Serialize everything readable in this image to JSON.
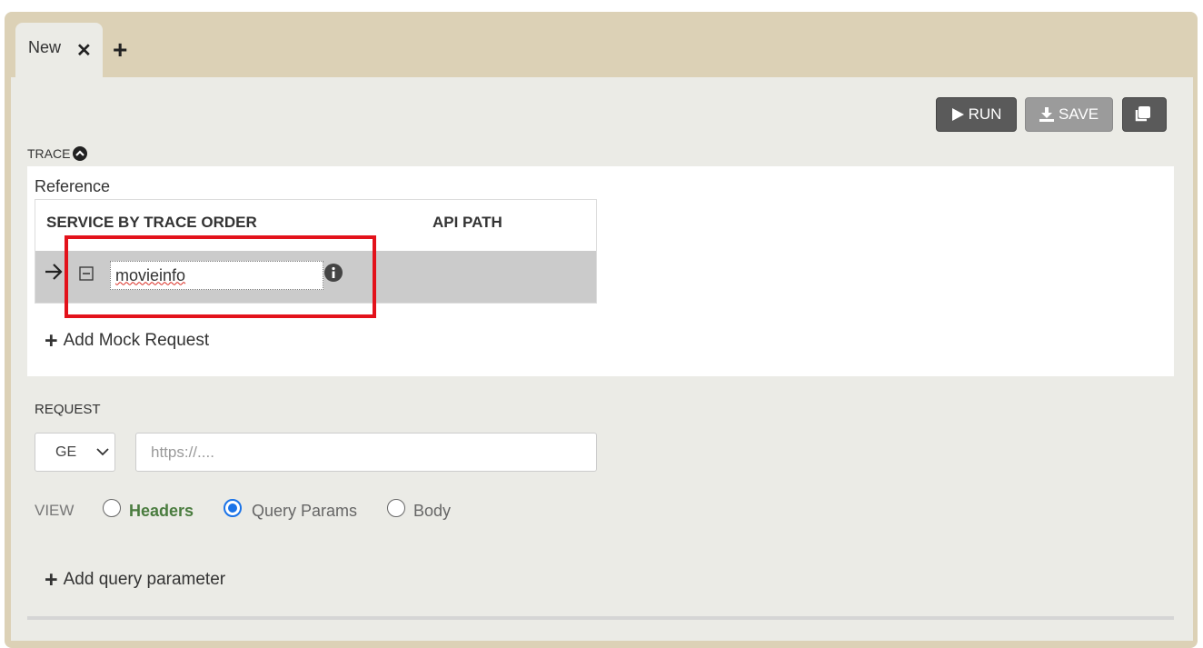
{
  "tabs": [
    {
      "label": "New"
    }
  ],
  "toolbar": {
    "run_label": "RUN",
    "save_label": "SAVE"
  },
  "trace": {
    "label": "TRACE",
    "reference_label": "Reference",
    "columns": [
      "SERVICE BY TRACE ORDER",
      "API PATH"
    ],
    "rows": [
      {
        "service": "movieinfo",
        "api_path": ""
      }
    ],
    "add_mock_label": "Add Mock Request"
  },
  "request": {
    "label": "REQUEST",
    "method": "GE",
    "url_value": "",
    "url_placeholder": "https://....",
    "view_label": "VIEW",
    "view_options": [
      {
        "label": "Headers",
        "selected": false
      },
      {
        "label": "Query Params",
        "selected": true
      },
      {
        "label": "Body",
        "selected": false
      }
    ],
    "add_param_label": "Add query parameter"
  },
  "colors": {
    "accent": "#1a73e8",
    "highlight": "#e3121b",
    "tab_bar": "#dcd1b6",
    "panel": "#ebebe6"
  },
  "icons": [
    "close-icon",
    "plus-icon",
    "play-icon",
    "download-icon",
    "copy-icon",
    "chevron-up-circle-icon",
    "arrow-right-icon",
    "collapse-icon",
    "info-icon",
    "chevron-down-icon"
  ]
}
